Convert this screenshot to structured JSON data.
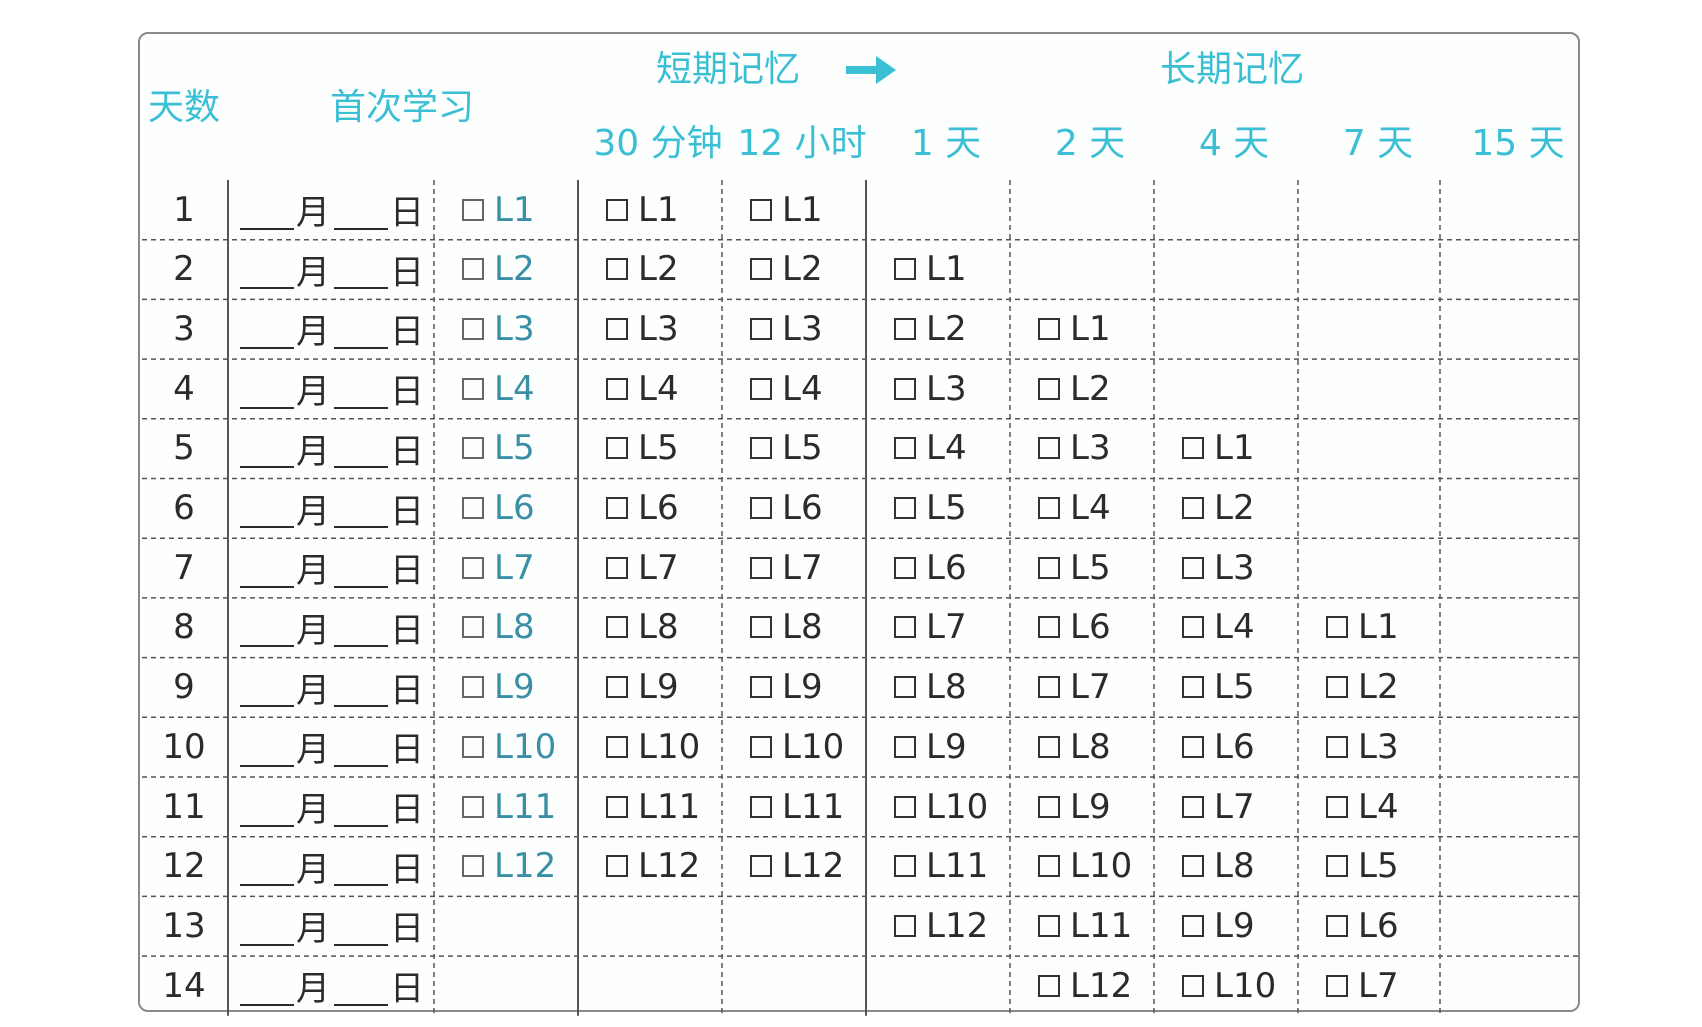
{
  "header": {
    "day_label": "天数",
    "first_study_label": "首次学习",
    "short_term_label": "短期记忆",
    "long_term_label": "长期记忆",
    "interval_labels": [
      "30 分钟",
      "12 小时",
      "1 天",
      "2 天",
      "4 天",
      "7 天",
      "15 天"
    ],
    "arrow_icon": "right-arrow-icon",
    "accent_color": "#3bbfd4"
  },
  "date_template": {
    "month": "月",
    "day": "日"
  },
  "rows": [
    {
      "day": "1",
      "cells": [
        "L1",
        "L1",
        "L1",
        "",
        "",
        "",
        "",
        ""
      ]
    },
    {
      "day": "2",
      "cells": [
        "L2",
        "L2",
        "L2",
        "L1",
        "",
        "",
        "",
        ""
      ]
    },
    {
      "day": "3",
      "cells": [
        "L3",
        "L3",
        "L3",
        "L2",
        "L1",
        "",
        "",
        ""
      ]
    },
    {
      "day": "4",
      "cells": [
        "L4",
        "L4",
        "L4",
        "L3",
        "L2",
        "",
        "",
        ""
      ]
    },
    {
      "day": "5",
      "cells": [
        "L5",
        "L5",
        "L5",
        "L4",
        "L3",
        "L1",
        "",
        ""
      ]
    },
    {
      "day": "6",
      "cells": [
        "L6",
        "L6",
        "L6",
        "L5",
        "L4",
        "L2",
        "",
        ""
      ]
    },
    {
      "day": "7",
      "cells": [
        "L7",
        "L7",
        "L7",
        "L6",
        "L5",
        "L3",
        "",
        ""
      ]
    },
    {
      "day": "8",
      "cells": [
        "L8",
        "L8",
        "L8",
        "L7",
        "L6",
        "L4",
        "L1",
        ""
      ]
    },
    {
      "day": "9",
      "cells": [
        "L9",
        "L9",
        "L9",
        "L8",
        "L7",
        "L5",
        "L2",
        ""
      ]
    },
    {
      "day": "10",
      "cells": [
        "L10",
        "L10",
        "L10",
        "L9",
        "L8",
        "L6",
        "L3",
        ""
      ]
    },
    {
      "day": "11",
      "cells": [
        "L11",
        "L11",
        "L11",
        "L10",
        "L9",
        "L7",
        "L4",
        ""
      ]
    },
    {
      "day": "12",
      "cells": [
        "L12",
        "L12",
        "L12",
        "L11",
        "L10",
        "L8",
        "L5",
        ""
      ]
    },
    {
      "day": "13",
      "cells": [
        "",
        "",
        "",
        "L12",
        "L11",
        "L9",
        "L6",
        ""
      ]
    },
    {
      "day": "14",
      "cells": [
        "",
        "",
        "",
        "",
        "L12",
        "L10",
        "L7",
        ""
      ]
    }
  ],
  "colors": {
    "accent": "#3bbfd4",
    "first_study_text": "#3a8fa6",
    "text": "#2b2b2b",
    "grid": "#555555"
  }
}
